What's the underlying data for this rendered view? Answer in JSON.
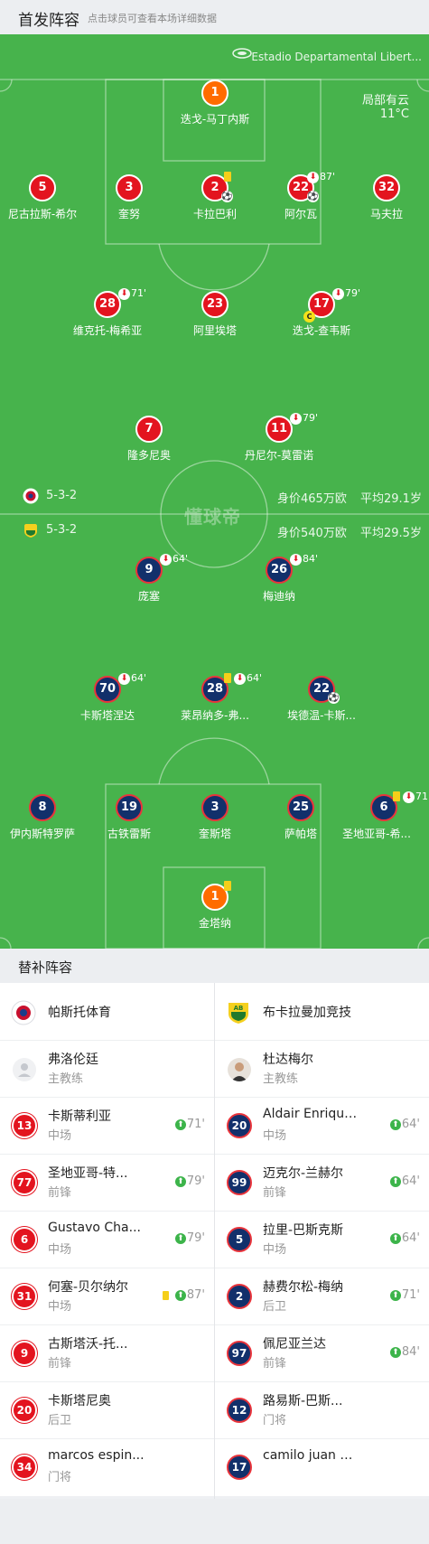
{
  "header": {
    "title": "首发阵容",
    "hint": "点击球员可查看本场详细数据"
  },
  "pitch": {
    "stadium": "Estadio Departamental Libert...",
    "weather": "局部有云",
    "temperature": "11°C",
    "watermark": "懂球帝"
  },
  "home": {
    "formation": "5-3-2",
    "value": "身价465万欧",
    "avg_age": "平均29.1岁",
    "color": "#e3141f",
    "players": [
      {
        "num": "1",
        "name": "迭戈-马丁内斯"
      },
      {
        "num": "5",
        "name": "尼古拉斯-希尔"
      },
      {
        "num": "3",
        "name": "奎努"
      },
      {
        "num": "2",
        "name": "卡拉巴利"
      },
      {
        "num": "22",
        "name": "阿尔瓦",
        "sub": "87'"
      },
      {
        "num": "32",
        "name": "马夫拉"
      },
      {
        "num": "28",
        "name": "维克托-梅希亚",
        "sub": "71'"
      },
      {
        "num": "23",
        "name": "阿里埃塔"
      },
      {
        "num": "17",
        "name": "迭戈-查韦斯",
        "sub": "79'"
      },
      {
        "num": "7",
        "name": "隆多尼奥"
      },
      {
        "num": "11",
        "name": "丹尼尔-莫雷诺",
        "sub": "79'"
      }
    ]
  },
  "away": {
    "formation": "5-3-2",
    "value": "身价540万欧",
    "avg_age": "平均29.5岁",
    "color": "#12306b",
    "players": [
      {
        "num": "9",
        "name": "庞塞",
        "sub": "64'"
      },
      {
        "num": "26",
        "name": "梅迪纳",
        "sub": "84'"
      },
      {
        "num": "70",
        "name": "卡斯塔涅达",
        "sub": "64'"
      },
      {
        "num": "28",
        "name": "莱昂纳多-弗...",
        "sub": "64'"
      },
      {
        "num": "22",
        "name": "埃德温-卡斯..."
      },
      {
        "num": "8",
        "name": "伊内斯特罗萨"
      },
      {
        "num": "19",
        "name": "古铁雷斯"
      },
      {
        "num": "3",
        "name": "奎斯塔"
      },
      {
        "num": "25",
        "name": "萨帕塔"
      },
      {
        "num": "6",
        "name": "圣地亚哥-希...",
        "sub": "71"
      },
      {
        "num": "1",
        "name": "金塔纳"
      }
    ]
  },
  "subs": {
    "title": "替补阵容",
    "home": {
      "team": "帕斯托体育",
      "coach": {
        "name": "弗洛伦廷",
        "role": "主教练"
      },
      "players": [
        {
          "num": "13",
          "name": "卡斯蒂利亚",
          "pos": "中场",
          "in": "71'"
        },
        {
          "num": "77",
          "name": "圣地亚哥-特...",
          "pos": "前锋",
          "in": "79'"
        },
        {
          "num": "6",
          "name": "Gustavo Cha...",
          "pos": "中场",
          "in": "79'"
        },
        {
          "num": "31",
          "name": "何塞-贝尔纳尔",
          "pos": "中场",
          "in": "87'"
        },
        {
          "num": "9",
          "name": "古斯塔沃-托...",
          "pos": "前锋",
          "in": ""
        },
        {
          "num": "20",
          "name": "卡斯塔尼奥",
          "pos": "后卫",
          "in": ""
        },
        {
          "num": "34",
          "name": "marcos espin...",
          "pos": "门将",
          "in": ""
        }
      ]
    },
    "away": {
      "team": "布卡拉曼加竞技",
      "coach": {
        "name": "杜达梅尔",
        "role": "主教练"
      },
      "players": [
        {
          "num": "20",
          "name": "Aldair Enrique...",
          "pos": "中场",
          "in": "64'"
        },
        {
          "num": "99",
          "name": "迈克尔-兰赫尔",
          "pos": "前锋",
          "in": "64'"
        },
        {
          "num": "5",
          "name": "拉里-巴斯克斯",
          "pos": "中场",
          "in": "64'"
        },
        {
          "num": "2",
          "name": "赫费尔松-梅纳",
          "pos": "后卫",
          "in": "71'"
        },
        {
          "num": "97",
          "name": "佩尼亚兰达",
          "pos": "前锋",
          "in": "84'"
        },
        {
          "num": "12",
          "name": "路易斯-巴斯...",
          "pos": "门将",
          "in": ""
        },
        {
          "num": "17",
          "name": "camilo juan m...",
          "pos": "",
          "in": ""
        }
      ]
    }
  }
}
